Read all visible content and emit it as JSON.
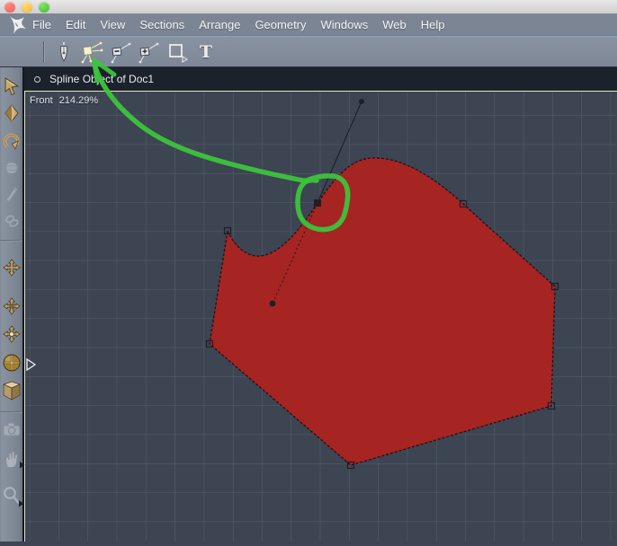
{
  "window": {
    "close_label": "close",
    "minimize_label": "minimize",
    "zoom_label": "zoom"
  },
  "menubar": {
    "items": [
      "File",
      "Edit",
      "View",
      "Sections",
      "Arrange",
      "Geometry",
      "Windows",
      "Web",
      "Help"
    ]
  },
  "toolbar": {
    "tools": [
      "pen-tool",
      "point-edit-tool (selected)",
      "delete-point-tool",
      "add-point-tool",
      "rectangle-tool",
      "text-tool"
    ],
    "text_tool_glyph": "T"
  },
  "sidebar": {
    "tools": [
      "select-arrow",
      "lasso-select",
      "rotate",
      "sphere (disabled)",
      "knife (disabled)",
      "link (disabled)",
      "move",
      "move-axis",
      "move-snap",
      "move-sphere",
      "box-view",
      "camera (disabled)",
      "pan-hand (disabled)",
      "zoom-magnifier (disabled)"
    ]
  },
  "viewport": {
    "title": "Spline Object of Doc1",
    "view_label": "Front",
    "zoom_level": "214.29%"
  },
  "annotation": {
    "description": "green hand-drawn loop around selected spline control point with arrow pointing to point-edit tool",
    "color": "#3cc43c"
  },
  "colors": {
    "shape_fill": "#a62421",
    "viewport_background": "#3d4452",
    "grid_line": "#565e6e",
    "active_view_border": "#e6e7c0",
    "chrome": "#7c8593",
    "header_bar": "#1c222c"
  }
}
